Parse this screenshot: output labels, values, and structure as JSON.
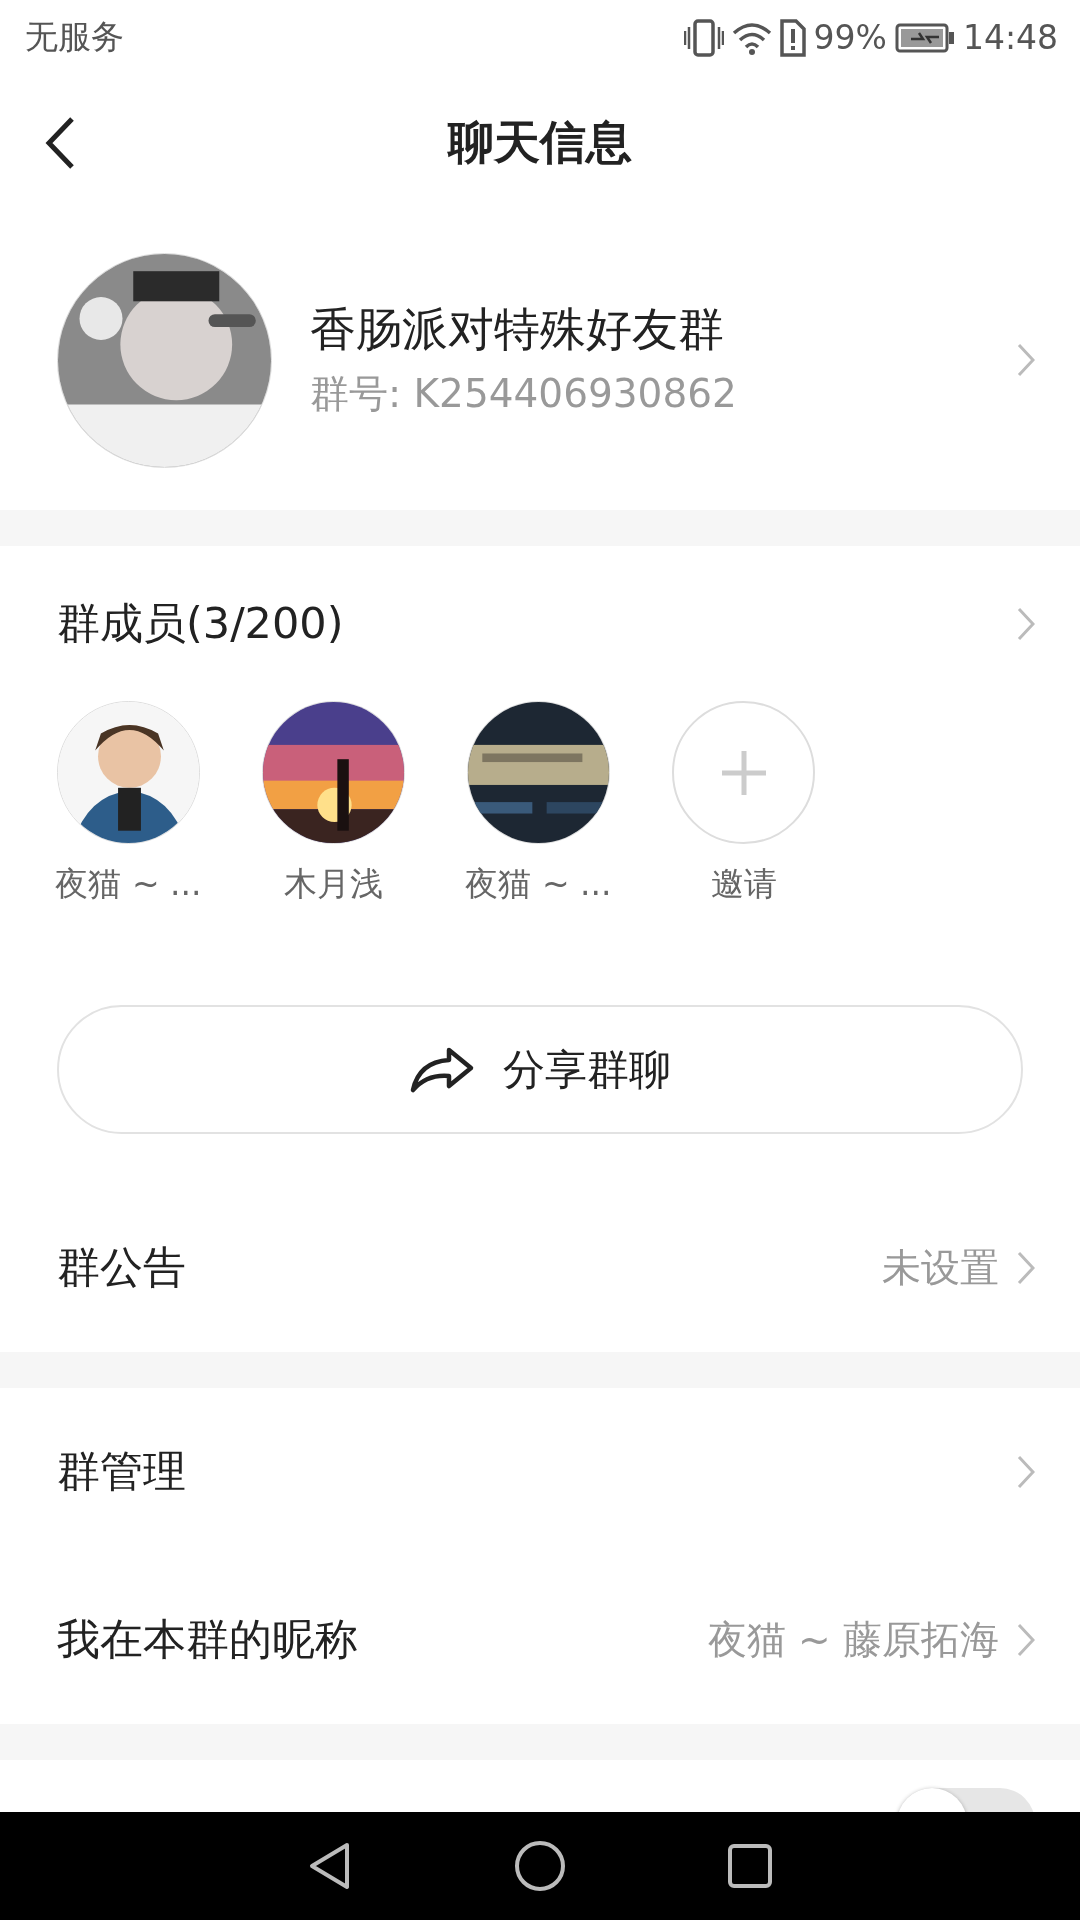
{
  "status_bar": {
    "carrier": "无服务",
    "battery": "99%",
    "time": "14:48"
  },
  "header": {
    "title": "聊天信息"
  },
  "group": {
    "name": "香肠派对特殊好友群",
    "number": "群号: K254406930862"
  },
  "members": {
    "title": "群成员(3/200)",
    "items": [
      {
        "kind": "avatar",
        "name": "夜猫 ~ ..."
      },
      {
        "kind": "avatar",
        "name": "木月浅"
      },
      {
        "kind": "avatar",
        "name": "夜猫 ~ ..."
      },
      {
        "kind": "invite",
        "name": "邀请"
      }
    ]
  },
  "share_button": {
    "label": "分享群聊"
  },
  "sections": [
    [
      {
        "kind": "link",
        "label": "群公告",
        "value": "未设置"
      }
    ],
    [
      {
        "kind": "link",
        "label": "群管理"
      },
      {
        "kind": "link",
        "label": "我在本群的昵称",
        "value": "夜猫 ~ 藤原拓海"
      }
    ],
    [
      {
        "kind": "toggle",
        "on": false
      }
    ]
  ]
}
